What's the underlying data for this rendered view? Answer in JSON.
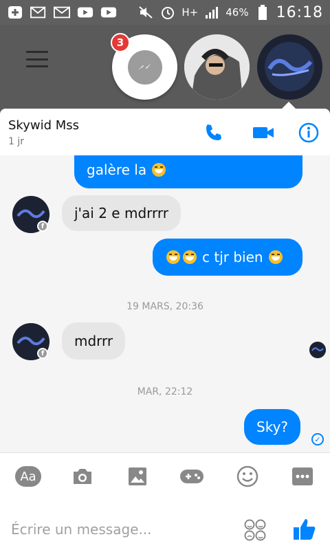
{
  "status_bar": {
    "battery": "46%",
    "time": "16:18",
    "network": "H+"
  },
  "chat_heads": {
    "badge_count": "3"
  },
  "header": {
    "name": "Skywid Mss",
    "subtitle": "1 jr"
  },
  "messages": [
    {
      "direction": "out",
      "text": "galère la"
    },
    {
      "direction": "in",
      "text": "j'ai 2 e mdrrrr"
    },
    {
      "direction": "out",
      "text": "c tjr bien"
    },
    {
      "direction": "in",
      "text": "mdrrr"
    },
    {
      "direction": "out",
      "text": "Sky?"
    }
  ],
  "timestamps": [
    "19 MARS, 20:36",
    "MAR, 22:12"
  ],
  "composer": {
    "aa_label": "Aa",
    "placeholder": "Écrire un message..."
  },
  "colors": {
    "accent": "#0084ff",
    "badge": "#e53935",
    "incoming": "#e6e6e6"
  }
}
